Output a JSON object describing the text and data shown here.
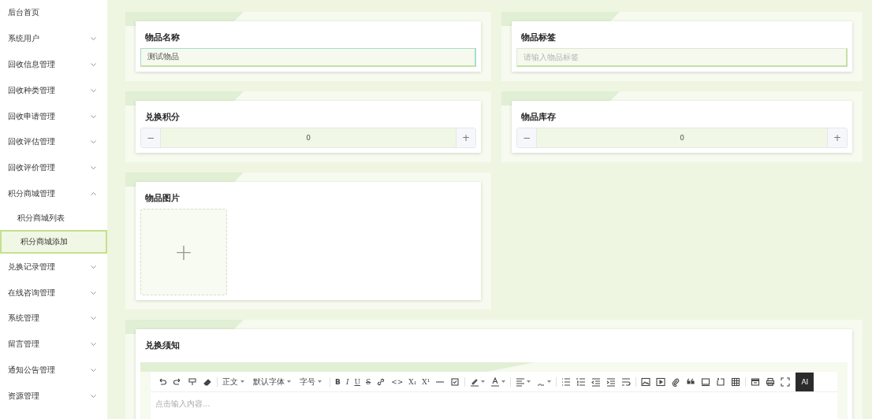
{
  "sidebar": {
    "items": [
      {
        "label": "后台首页"
      },
      {
        "label": "系统用户",
        "expanded": false
      },
      {
        "label": "回收信息管理",
        "expanded": false
      },
      {
        "label": "回收种类管理",
        "expanded": false
      },
      {
        "label": "回收申请管理",
        "expanded": false
      },
      {
        "label": "回收评估管理",
        "expanded": false
      },
      {
        "label": "回收评价管理",
        "expanded": false
      },
      {
        "label": "积分商城管理",
        "expanded": true,
        "children": [
          {
            "label": "积分商城列表",
            "selected": false
          },
          {
            "label": "积分商城添加",
            "selected": true
          }
        ]
      },
      {
        "label": "兑换记录管理",
        "expanded": false
      },
      {
        "label": "在线咨询管理",
        "expanded": false
      },
      {
        "label": "系统管理",
        "expanded": false
      },
      {
        "label": "留言管理",
        "expanded": false
      },
      {
        "label": "通知公告管理",
        "expanded": false
      },
      {
        "label": "资源管理",
        "expanded": false
      }
    ]
  },
  "form": {
    "fields": [
      {
        "kind": "text",
        "label": "物品名称",
        "value": "测试物品",
        "focused": true
      },
      {
        "kind": "text",
        "label": "物品标签",
        "placeholder": "请输入物品标签",
        "focused": false
      },
      {
        "kind": "number",
        "label": "兑换积分",
        "value": "0",
        "minus": "−",
        "plus": "+"
      },
      {
        "kind": "number",
        "label": "物品库存",
        "value": "0",
        "minus": "−",
        "plus": "+"
      },
      {
        "kind": "upload",
        "label": "物品图片",
        "plus": "+"
      }
    ],
    "editor": {
      "label": "兑换须知",
      "placeholder": "点击输入内容...",
      "toolbar": [
        [
          {
            "kind": "undo"
          },
          {
            "kind": "redo"
          },
          {
            "kind": "painter"
          },
          {
            "kind": "eraser"
          }
        ],
        [
          {
            "kind": "dropdown",
            "label": "正文"
          },
          {
            "kind": "dropdown",
            "label": "默认字体"
          },
          {
            "kind": "dropdown",
            "label": "字号"
          }
        ],
        [
          {
            "kind": "bold",
            "label": "B"
          },
          {
            "kind": "italic",
            "label": "I"
          },
          {
            "kind": "underline",
            "label": "U"
          },
          {
            "kind": "strike",
            "label": "S"
          },
          {
            "kind": "link"
          },
          {
            "kind": "plain",
            "label": "<>"
          },
          {
            "kind": "plain",
            "label": "X₁"
          },
          {
            "kind": "plain",
            "label": "X¹"
          },
          {
            "kind": "rule"
          },
          {
            "kind": "todo"
          }
        ],
        [
          {
            "kind": "highlight"
          },
          {
            "kind": "fontcolor"
          }
        ],
        [
          {
            "kind": "align"
          },
          {
            "kind": "lineheight"
          }
        ],
        [
          {
            "kind": "bullets"
          },
          {
            "kind": "numbers"
          },
          {
            "kind": "outdent"
          },
          {
            "kind": "indent"
          },
          {
            "kind": "wrap"
          }
        ],
        [
          {
            "kind": "image"
          },
          {
            "kind": "video"
          },
          {
            "kind": "attach"
          },
          {
            "kind": "quote"
          },
          {
            "kind": "codeblock"
          },
          {
            "kind": "divider"
          },
          {
            "kind": "table"
          }
        ],
        [
          {
            "kind": "preview"
          },
          {
            "kind": "print"
          },
          {
            "kind": "fullscreen"
          },
          {
            "kind": "ai",
            "label": "AI"
          }
        ]
      ]
    }
  }
}
